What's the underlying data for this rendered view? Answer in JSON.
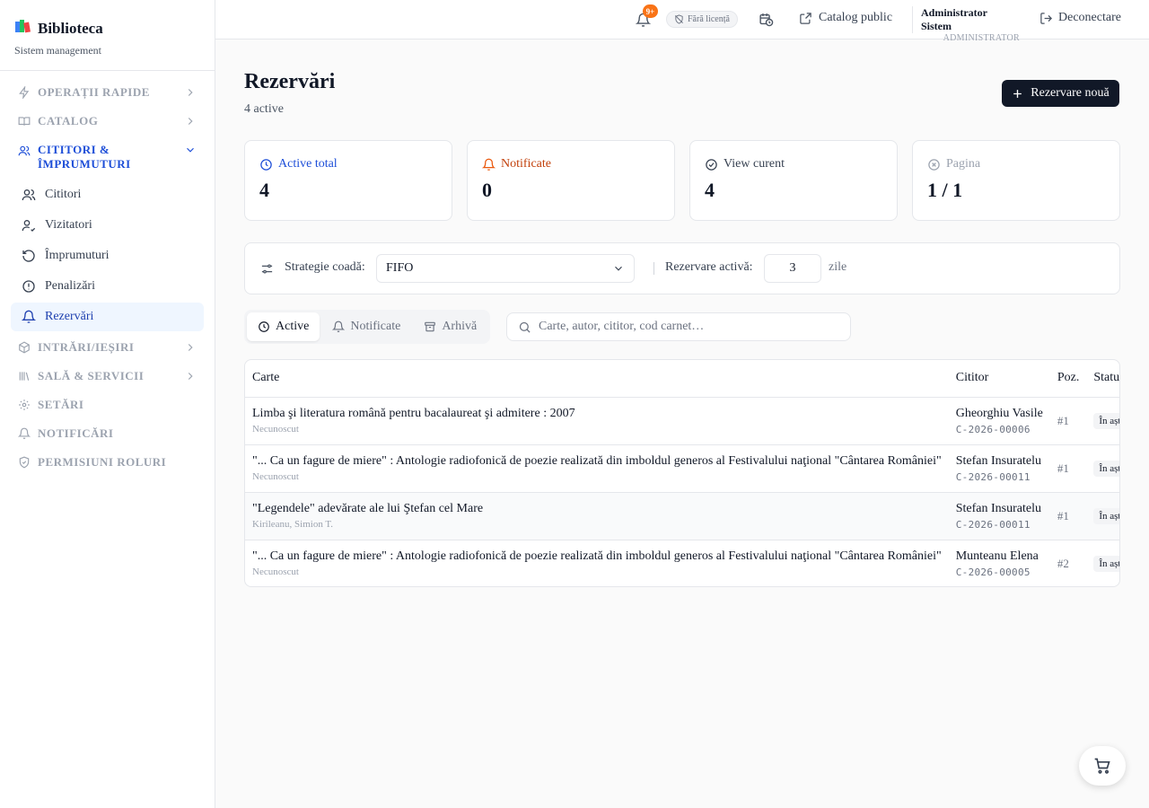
{
  "brand": {
    "title": "Biblioteca",
    "subtitle": "Sistem management"
  },
  "sidebar": {
    "groups": [
      {
        "label": "OPERAȚII RAPIDE"
      },
      {
        "label": "CATALOG"
      },
      {
        "label": "CITITORI & ÎMPRUMUTURI"
      },
      {
        "label": "INTRĂRI/IEȘIRI"
      },
      {
        "label": "SALĂ & SERVICII"
      },
      {
        "label": "SETĂRI"
      },
      {
        "label": "NOTIFICĂRI"
      },
      {
        "label": "PERMISIUNI ROLURI"
      }
    ],
    "items": [
      {
        "label": "Cititori"
      },
      {
        "label": "Vizitatori"
      },
      {
        "label": "Împrumuturi"
      },
      {
        "label": "Penalizări"
      },
      {
        "label": "Rezervări"
      }
    ]
  },
  "topbar": {
    "notif_badge": "9+",
    "license_label": "Fără licență",
    "catalog_label": "Catalog public",
    "user_name": "Administrator Sistem",
    "user_role": "ADMINISTRATOR",
    "logout_label": "Deconectare"
  },
  "page": {
    "title": "Rezervări",
    "subtitle": "4 active",
    "new_button": "Rezervare nouă"
  },
  "stats": [
    {
      "label": "Active total",
      "value": "4",
      "color": "#1d4ed8"
    },
    {
      "label": "Notificate",
      "value": "0",
      "color": "#c2410c"
    },
    {
      "label": "View curent",
      "value": "4",
      "color": "#374151"
    },
    {
      "label": "Pagina",
      "value": "1 / 1",
      "color": "#9ca3af"
    }
  ],
  "strategy": {
    "label": "Strategie coadă:",
    "value": "FIFO",
    "active_label": "Rezervare activă:",
    "days": "3",
    "days_unit": "zile"
  },
  "tabs": [
    {
      "label": "Active"
    },
    {
      "label": "Notificate"
    },
    {
      "label": "Arhivă"
    }
  ],
  "search": {
    "placeholder": "Carte, autor, cititor, cod carnet…"
  },
  "table": {
    "headers": [
      "Carte",
      "Cititor",
      "Poz.",
      "Status"
    ],
    "rows": [
      {
        "title": "Limba şi literatura română pentru bacalaureat şi admitere : 2007",
        "author": "Necunoscut",
        "reader": "Gheorghiu Vasile",
        "card": "C-2026-00006",
        "pos": "#1",
        "status": "În așteptare"
      },
      {
        "title": "\"... Ca un fagure de miere\" : Antologie radiofonică de poezie realizată din imboldul generos al Festivalului naţional \"Cântarea României\"",
        "author": "Necunoscut",
        "reader": "Stefan Insuratelu",
        "card": "C-2026-00011",
        "pos": "#1",
        "status": "În așteptare"
      },
      {
        "title": "\"Legendele\" adevărate ale lui Ştefan cel Mare",
        "author": "Kirileanu, Simion T.",
        "reader": "Stefan Insuratelu",
        "card": "C-2026-00011",
        "pos": "#1",
        "status": "În așteptare"
      },
      {
        "title": "\"... Ca un fagure de miere\" : Antologie radiofonică de poezie realizată din imboldul generos al Festivalului naţional \"Cântarea României\"",
        "author": "Necunoscut",
        "reader": "Munteanu Elena",
        "card": "C-2026-00005",
        "pos": "#2",
        "status": "În așteptare"
      }
    ]
  }
}
